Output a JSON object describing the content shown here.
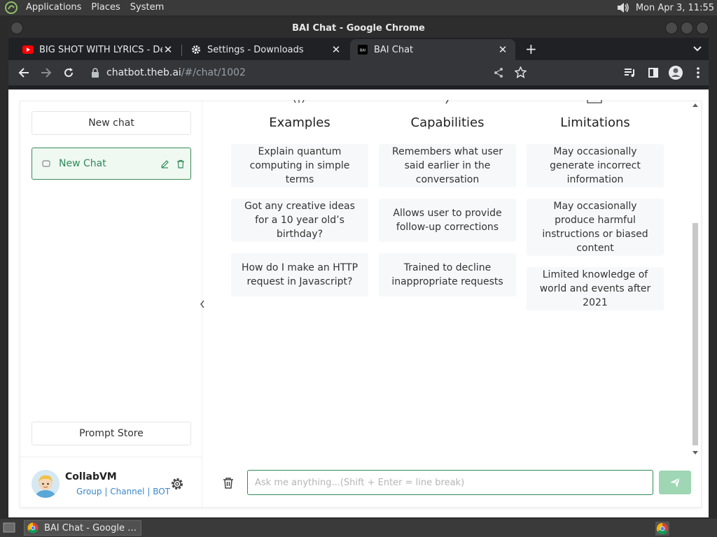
{
  "panel": {
    "menus": [
      "Applications",
      "Places",
      "System"
    ],
    "datetime": "Mon Apr  3, 11:55"
  },
  "window": {
    "title": "BAI Chat - Google Chrome"
  },
  "tabs": [
    {
      "title": "BIG SHOT WITH LYRICS - Deltarune",
      "icon": "youtube-icon"
    },
    {
      "title": "Settings - Downloads",
      "icon": "gear-icon"
    },
    {
      "title": "BAI Chat",
      "icon": "bai-icon",
      "active": true
    }
  ],
  "toolbar": {
    "url_host": "chatbot.theb.ai",
    "url_path": "/#/chat/1002"
  },
  "sidebar": {
    "new_chat_label": "New chat",
    "chat_items": [
      {
        "label": "New Chat"
      }
    ],
    "prompt_store_label": "Prompt Store",
    "user": {
      "name": "CollabVM",
      "links": [
        "Group",
        "Channel",
        "BOT"
      ]
    }
  },
  "main": {
    "columns": [
      {
        "heading": "Examples",
        "items": [
          "Explain quantum computing in simple terms",
          "Got any creative ideas for a 10 year old’s birthday?",
          "How do I make an HTTP request in Javascript?"
        ]
      },
      {
        "heading": "Capabilities",
        "items": [
          "Remembers what user said earlier in the conversation",
          "Allows user to provide follow-up corrections",
          "Trained to decline inappropriate requests"
        ]
      },
      {
        "heading": "Limitations",
        "items": [
          "May occasionally generate incorrect information",
          "May occasionally produce harmful instructions or biased content",
          "Limited knowledge of world and events after 2021"
        ]
      }
    ],
    "input": {
      "placeholder": "Ask me anything...(Shift + Enter = line break)",
      "value": ""
    }
  },
  "taskbar": {
    "item_label": "BAI Chat - Google Chrome"
  },
  "colors": {
    "accent": "#2e8b57",
    "send_button": "#9fd6b3"
  }
}
